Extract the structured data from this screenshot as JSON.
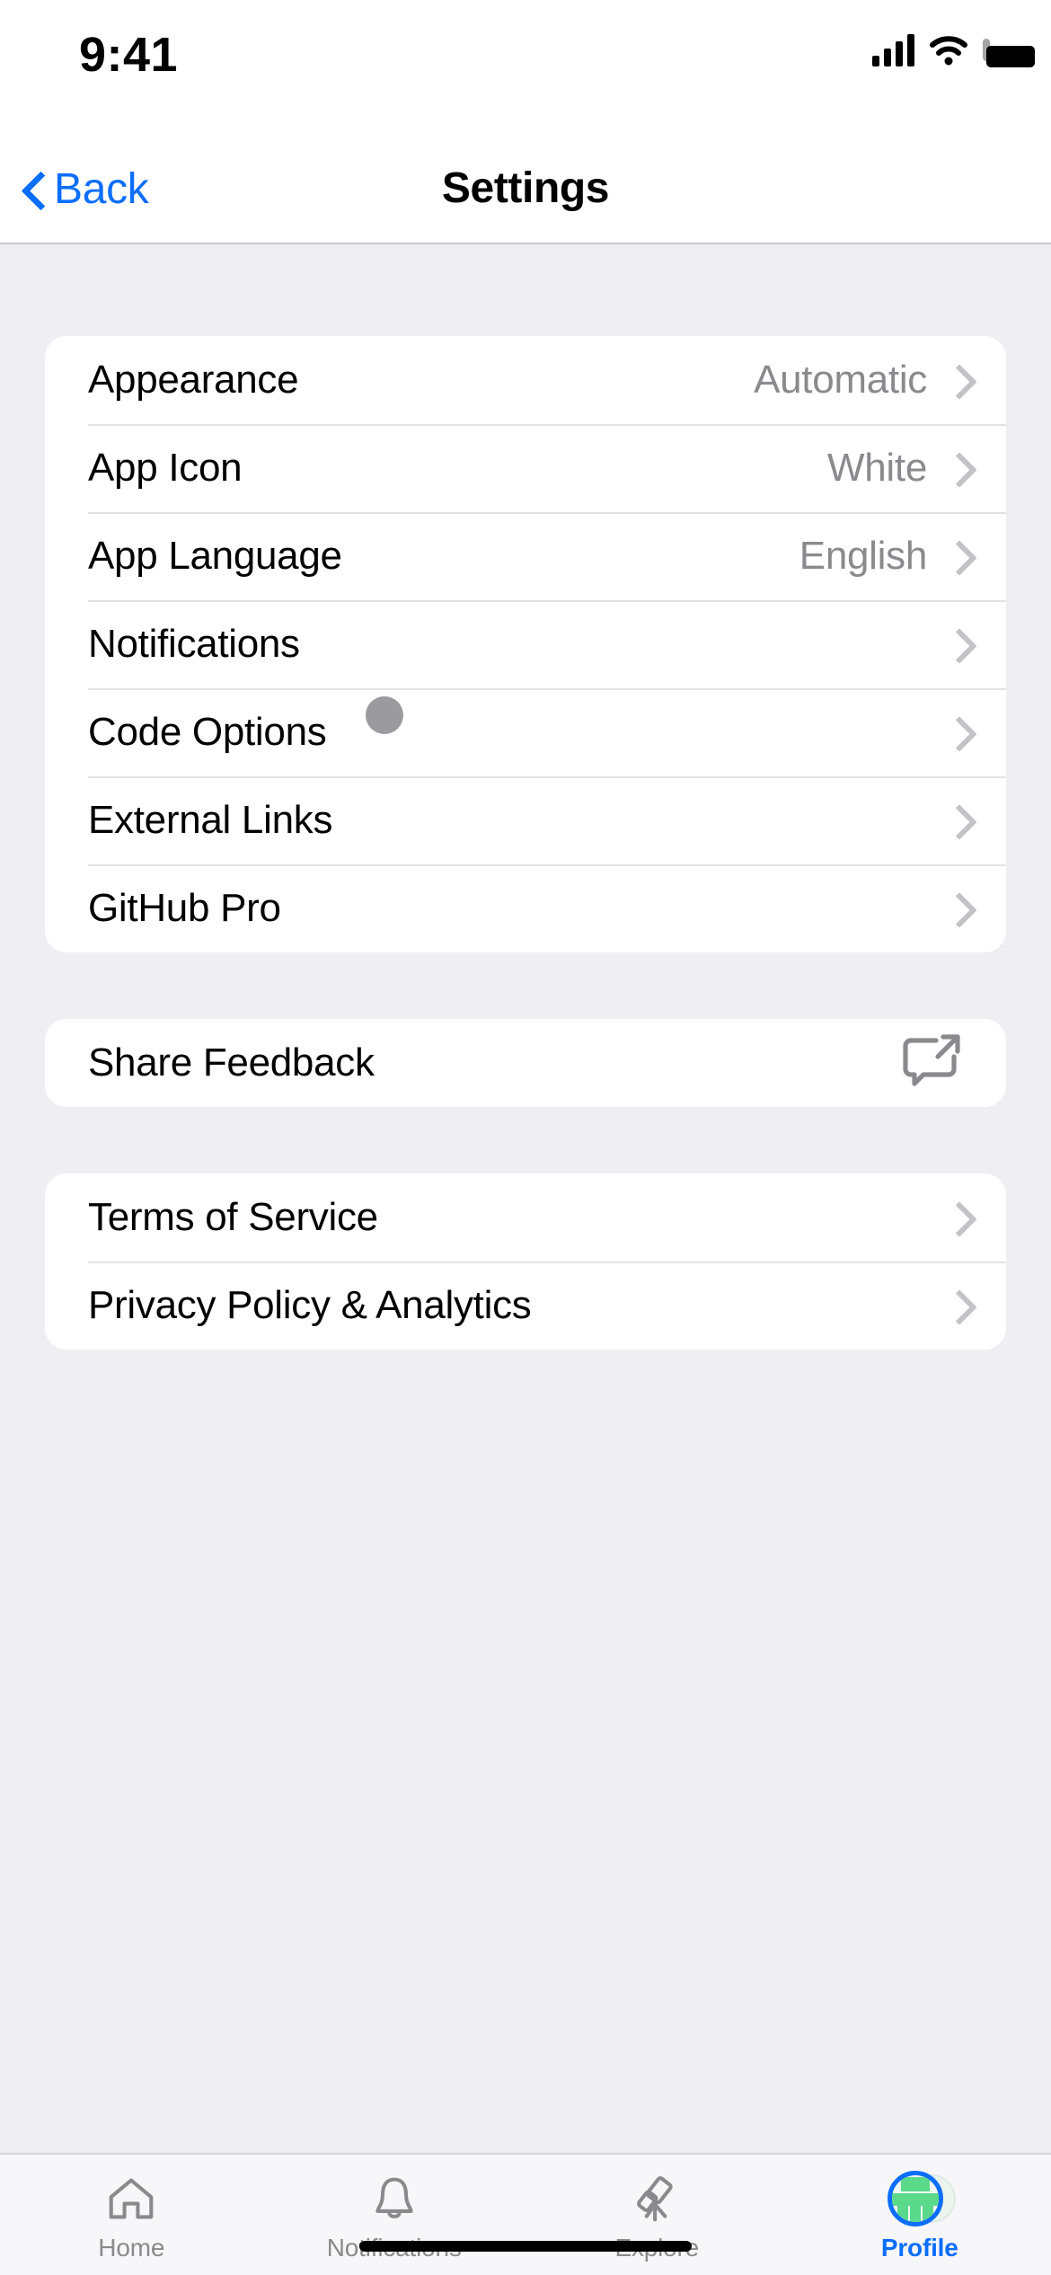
{
  "status_bar": {
    "time": "9:41",
    "cellular_icon": "cellular-bars-icon",
    "wifi_icon": "wifi-icon",
    "battery_icon": "battery-full-icon"
  },
  "nav": {
    "back_label": "Back",
    "back_icon": "chevron-left-icon",
    "title": "Settings"
  },
  "sections": [
    {
      "name": "preferences",
      "rows": [
        {
          "label": "Appearance",
          "value": "Automatic",
          "accessory": "chevron-right-icon",
          "badge": false
        },
        {
          "label": "App Icon",
          "value": "White",
          "accessory": "chevron-right-icon",
          "badge": false
        },
        {
          "label": "App Language",
          "value": "English",
          "accessory": "chevron-right-icon",
          "badge": false
        },
        {
          "label": "Notifications",
          "value": "",
          "accessory": "chevron-right-icon",
          "badge": false
        },
        {
          "label": "Code Options",
          "value": "",
          "accessory": "chevron-right-icon",
          "badge": true
        },
        {
          "label": "External Links",
          "value": "",
          "accessory": "chevron-right-icon",
          "badge": false
        },
        {
          "label": "GitHub Pro",
          "value": "",
          "accessory": "chevron-right-icon",
          "badge": false
        }
      ]
    },
    {
      "name": "feedback",
      "rows": [
        {
          "label": "Share Feedback",
          "value": "",
          "accessory": "share-bubble-icon",
          "badge": false
        }
      ]
    },
    {
      "name": "legal",
      "rows": [
        {
          "label": "Terms of Service",
          "value": "",
          "accessory": "chevron-right-icon",
          "badge": false
        },
        {
          "label": "Privacy Policy & Analytics",
          "value": "",
          "accessory": "chevron-right-icon",
          "badge": false
        }
      ]
    }
  ],
  "tabs": [
    {
      "label": "Home",
      "icon": "house-icon",
      "active": false
    },
    {
      "label": "Notifications",
      "icon": "bell-icon",
      "active": false
    },
    {
      "label": "Explore",
      "icon": "telescope-icon",
      "active": false
    },
    {
      "label": "Profile",
      "icon": "avatar-icon",
      "active": true
    }
  ],
  "colors": {
    "accent": "#0b6efd",
    "background": "#eeeef3",
    "card": "#ffffff",
    "secondary_text": "#8a8a8e",
    "badge": "#9a9a9f",
    "avatar_green": "#5bd98a"
  }
}
